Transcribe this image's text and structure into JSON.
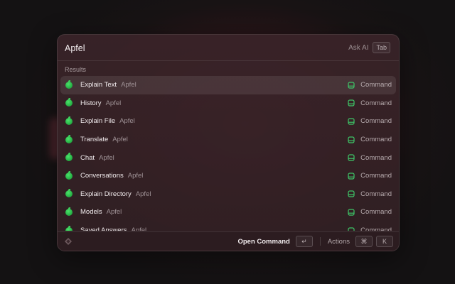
{
  "search": {
    "value": "Apfel",
    "ask_ai_label": "Ask AI",
    "ask_ai_key": "Tab"
  },
  "results": {
    "section_title": "Results",
    "items": [
      {
        "title": "Explain Text",
        "subtitle": "Apfel",
        "type": "Command",
        "selected": true
      },
      {
        "title": "History",
        "subtitle": "Apfel",
        "type": "Command"
      },
      {
        "title": "Explain File",
        "subtitle": "Apfel",
        "type": "Command"
      },
      {
        "title": "Translate",
        "subtitle": "Apfel",
        "type": "Command"
      },
      {
        "title": "Chat",
        "subtitle": "Apfel",
        "type": "Command"
      },
      {
        "title": "Conversations",
        "subtitle": "Apfel",
        "type": "Command"
      },
      {
        "title": "Explain Directory",
        "subtitle": "Apfel",
        "type": "Command"
      },
      {
        "title": "Models",
        "subtitle": "Apfel",
        "type": "Command"
      },
      {
        "title": "Saved Answers",
        "subtitle": "Apfel",
        "type": "Command"
      }
    ]
  },
  "footer": {
    "primary_action": "Open Command",
    "primary_key": "↵",
    "actions_label": "Actions",
    "actions_keys": [
      "⌘",
      "K"
    ]
  },
  "icons": {
    "app": "apple-icon",
    "command": "command-icon",
    "footer_logo": "raycast-logo-icon"
  },
  "colors": {
    "app_icon_green": "#2fc14d",
    "command_icon_green": "#3ec768",
    "selected_row_bg": "#4a3338"
  }
}
